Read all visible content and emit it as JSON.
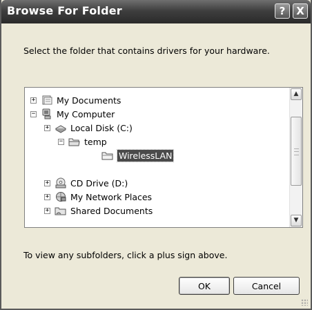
{
  "window": {
    "title": "Browse For Folder",
    "help_label": "?",
    "close_label": "X"
  },
  "instruction": "Select the folder that contains drivers for your hardware.",
  "tree": {
    "items": [
      {
        "label": "My Documents",
        "expander": "+",
        "icon": "my-documents-icon"
      },
      {
        "label": "My Computer",
        "expander": "−",
        "icon": "my-computer-icon"
      },
      {
        "label": "Local Disk (C:)",
        "expander": "+",
        "icon": "local-disk-icon"
      },
      {
        "label": "temp",
        "expander": "−",
        "icon": "folder-open-icon"
      },
      {
        "label": "WirelessLAN",
        "expander": "",
        "icon": "folder-icon",
        "selected": true
      },
      {
        "label": "CD Drive (D:)",
        "expander": "+",
        "icon": "cd-drive-icon"
      },
      {
        "label": "My Network Places",
        "expander": "+",
        "icon": "network-places-icon"
      },
      {
        "label": "Shared Documents",
        "expander": "+",
        "icon": "shared-documents-icon"
      }
    ],
    "scroll_up_label": "▲",
    "scroll_down_label": "▼"
  },
  "hint": "To view any subfolders, click a plus sign above.",
  "buttons": {
    "ok_label": "OK",
    "cancel_label": "Cancel"
  },
  "colors": {
    "titlebar": "#3f3f3f",
    "selection": "#4a4a4a",
    "dialog_background": "#ece9d8"
  }
}
